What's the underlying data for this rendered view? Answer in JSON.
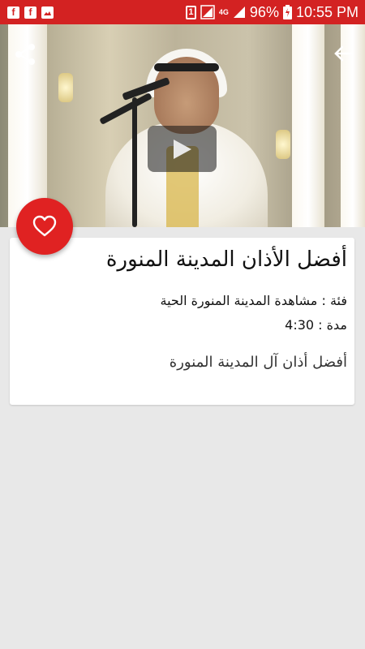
{
  "status_bar": {
    "left_icons": [
      "facebook-icon",
      "facebook-icon",
      "image-icon"
    ],
    "sim_label": "1",
    "network_label": "4G",
    "battery_percent": "96%",
    "time": "10:55 PM"
  },
  "video": {
    "play_icon": "play-icon",
    "share_icon": "share-icon",
    "back_icon": "back-arrow-icon"
  },
  "favorite_icon": "heart-icon",
  "details": {
    "title": "أفضل الأذان المدينة المنورة",
    "category_label": "فئة : ",
    "category_value": "مشاهدة المدينة المنورة الحية",
    "duration_label": "مدة : ",
    "duration_value": "4:30",
    "description": "أفضل أذان آل المدينة المنورة"
  },
  "colors": {
    "accent": "#d32222",
    "fab": "#e02222",
    "background": "#e8e8e8"
  }
}
